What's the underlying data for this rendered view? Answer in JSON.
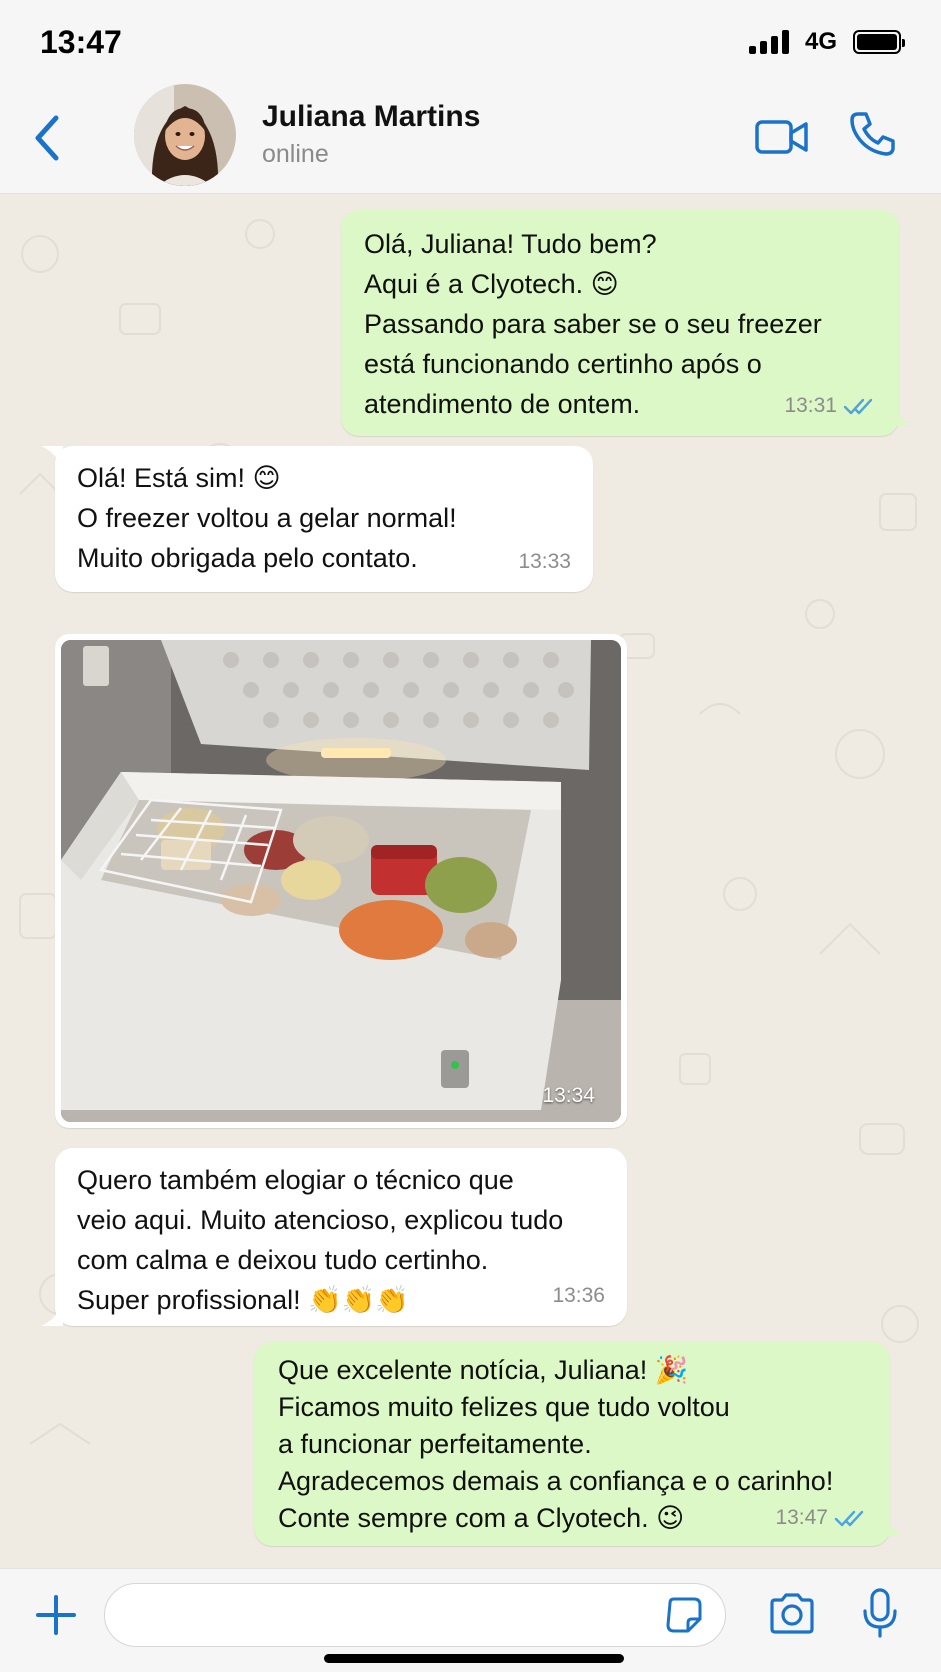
{
  "status_bar": {
    "time": "13:47",
    "network": "4G"
  },
  "header": {
    "contact_name": "Juliana Martins",
    "contact_status": "online",
    "icons": {
      "back": "chevron-left-icon",
      "video": "video-camera-icon",
      "phone": "phone-icon"
    }
  },
  "messages": [
    {
      "direction": "outgoing",
      "lines": [
        "Olá, Juliana! Tudo bem?",
        "Aqui é a Clyotech. 😊",
        "Passando para saber se o seu freezer",
        "está funcionando certinho após o",
        "atendimento de ontem."
      ],
      "time": "13:31",
      "read": true
    },
    {
      "direction": "incoming",
      "lines": [
        "Olá! Está sim! 😊",
        "O freezer voltou a gelar normal!",
        "Muito obrigada pelo contato."
      ],
      "time": "13:33"
    },
    {
      "direction": "incoming",
      "type": "photo",
      "photo_subject": "chest freezer open with frozen food",
      "time": "13:34"
    },
    {
      "direction": "incoming",
      "lines": [
        "Quero também elogiar o técnico que",
        "veio aqui. Muito atencioso, explicou tudo",
        "com calma e deixou tudo certinho.",
        "Super profissional! 👏👏👏"
      ],
      "time": "13:36"
    },
    {
      "direction": "outgoing",
      "lines": [
        "Que excelente notícia, Juliana! 🎉",
        "Ficamos muito felizes que tudo voltou",
        "a funcionar perfeitamente.",
        "Agradecemos demais a confiança e o carinho!",
        "Conte sempre com a Clyotech. 😉"
      ],
      "time": "13:47",
      "read": true
    }
  ],
  "input_bar": {
    "placeholder": "",
    "value": "",
    "icons": {
      "attach": "plus-icon",
      "sticker": "sticker-icon",
      "camera": "camera-icon",
      "mic": "microphone-icon"
    }
  },
  "colors": {
    "accent": "#1a73c9",
    "outgoing_bubble": "#dcf8c6",
    "incoming_bubble": "#ffffff",
    "chat_background": "#efeae2",
    "read_ticks": "#4fa3e0"
  }
}
